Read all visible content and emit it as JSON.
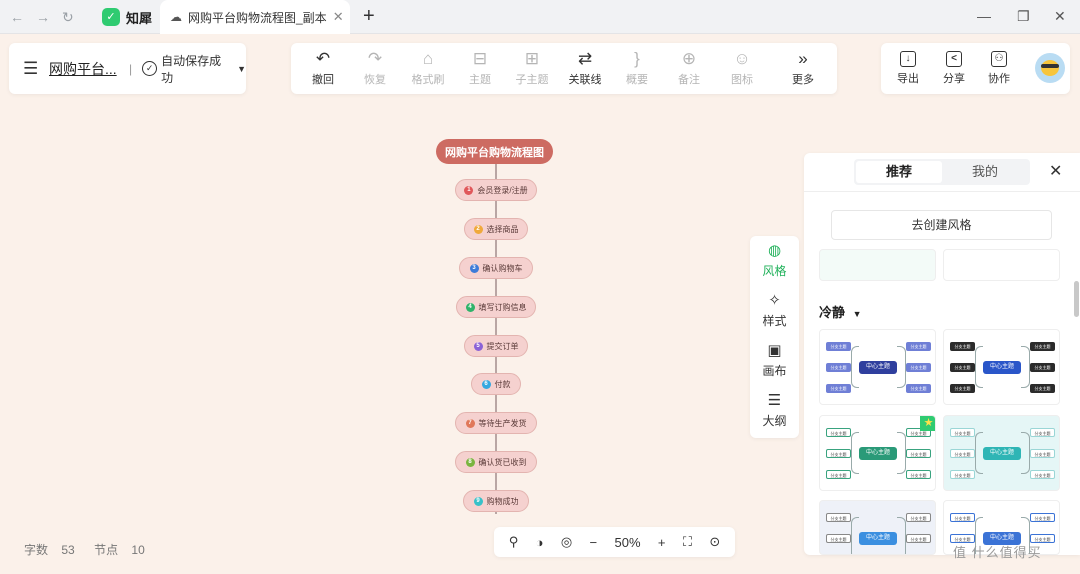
{
  "browser": {
    "app_name": "知犀",
    "app_logo_icon": "zhixi-logo-icon",
    "tab_title": "网购平台购物流程图_副本"
  },
  "file": {
    "name": "网购平台...",
    "save_status": "自动保存成功"
  },
  "toolbar": [
    {
      "icon": "undo-icon",
      "glyph": "↶",
      "label": "撤回",
      "enabled": true
    },
    {
      "icon": "redo-icon",
      "glyph": "↷",
      "label": "恢复",
      "enabled": false
    },
    {
      "icon": "format-brush-icon",
      "glyph": "⌂",
      "label": "格式刷",
      "enabled": false
    },
    {
      "icon": "topic-icon",
      "glyph": "⊟",
      "label": "主题",
      "enabled": false
    },
    {
      "icon": "subtopic-icon",
      "glyph": "⊞",
      "label": "子主题",
      "enabled": false
    },
    {
      "icon": "relation-line-icon",
      "glyph": "⇄",
      "label": "关联线",
      "enabled": true
    },
    {
      "icon": "summary-icon",
      "glyph": "}",
      "label": "概要",
      "enabled": false
    },
    {
      "icon": "note-icon",
      "glyph": "⊕",
      "label": "备注",
      "enabled": false
    },
    {
      "icon": "emoji-icon",
      "glyph": "☺",
      "label": "图标",
      "enabled": false
    },
    {
      "icon": "more-icon",
      "glyph": "»",
      "label": "更多",
      "enabled": true
    }
  ],
  "right_toolbar": [
    {
      "icon": "export-icon",
      "glyph": "↓",
      "label": "导出"
    },
    {
      "icon": "share-icon",
      "glyph": "<",
      "label": "分享"
    },
    {
      "icon": "collaborate-icon",
      "glyph": "⚇",
      "label": "协作"
    }
  ],
  "mindmap": {
    "root": "网购平台购物流程图",
    "nodes": [
      {
        "num": "1",
        "label": "会员登录/注册",
        "color": "#e0575a"
      },
      {
        "num": "2",
        "label": "选择商品",
        "color": "#f0a93b"
      },
      {
        "num": "3",
        "label": "确认购物车",
        "color": "#3d7bd8"
      },
      {
        "num": "4",
        "label": "填写订购信息",
        "color": "#2fb36a"
      },
      {
        "num": "5",
        "label": "提交订单",
        "color": "#8b62d6"
      },
      {
        "num": "6",
        "label": "付款",
        "color": "#35a8e0"
      },
      {
        "num": "7",
        "label": "等待生产发货",
        "color": "#e0785a"
      },
      {
        "num": "8",
        "label": "确认货已收到",
        "color": "#7ab540"
      },
      {
        "num": "9",
        "label": "购物成功",
        "color": "#38c1c9"
      }
    ]
  },
  "status": {
    "word_count_label": "字数",
    "word_count": "53",
    "node_count_label": "节点",
    "node_count": "10"
  },
  "zoom": {
    "level": "50%",
    "minus": "−",
    "plus": "+"
  },
  "side_tabs": [
    {
      "icon": "palette-icon",
      "glyph": "◍",
      "label": "风格",
      "active": true
    },
    {
      "icon": "style-icon",
      "glyph": "✧",
      "label": "样式",
      "active": false
    },
    {
      "icon": "canvas-icon",
      "glyph": "▣",
      "label": "画布",
      "active": false
    },
    {
      "icon": "outline-icon",
      "glyph": "☰",
      "label": "大纲",
      "active": false
    }
  ],
  "style_panel": {
    "tabs": [
      "推荐",
      "我的"
    ],
    "create_button": "去创建风格",
    "section_title": "冷静",
    "thumb_center_label": "中心主题",
    "thumb_branch_label": "分支主题"
  },
  "watermark": "值 什么值得买"
}
